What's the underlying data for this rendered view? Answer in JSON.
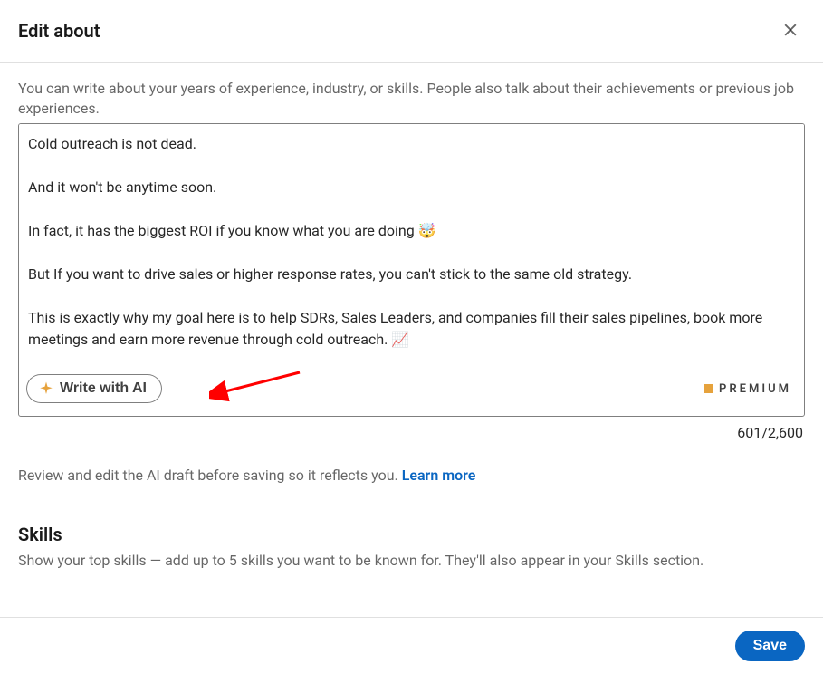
{
  "modal": {
    "title": "Edit about",
    "hint": "You can write about your years of experience, industry, or skills. People also talk about their achievements or previous job experiences.",
    "about_text": "Cold outreach is not dead.\n\nAnd it won't be anytime soon.\n\nIn fact, it has the biggest ROI if you know what you are doing 🤯\n\nBut If you want to drive sales or higher response rates, you can't stick to the same old strategy.\n\nThis is exactly why my goal here is to help SDRs, Sales Leaders, and companies fill their sales pipelines, book more meetings and earn more revenue through cold outreach. 📈\n\n",
    "ai_button_label": "Write with AI",
    "premium_label": "PREMIUM",
    "counter": "601/2,600",
    "review_text": "Review and edit the AI draft before saving so it reflects you. ",
    "learn_more": "Learn more",
    "skills_heading": "Skills",
    "skills_sub": "Show your top skills — add up to 5 skills you want to be known for. They'll also appear in your Skills section.",
    "save_label": "Save"
  }
}
